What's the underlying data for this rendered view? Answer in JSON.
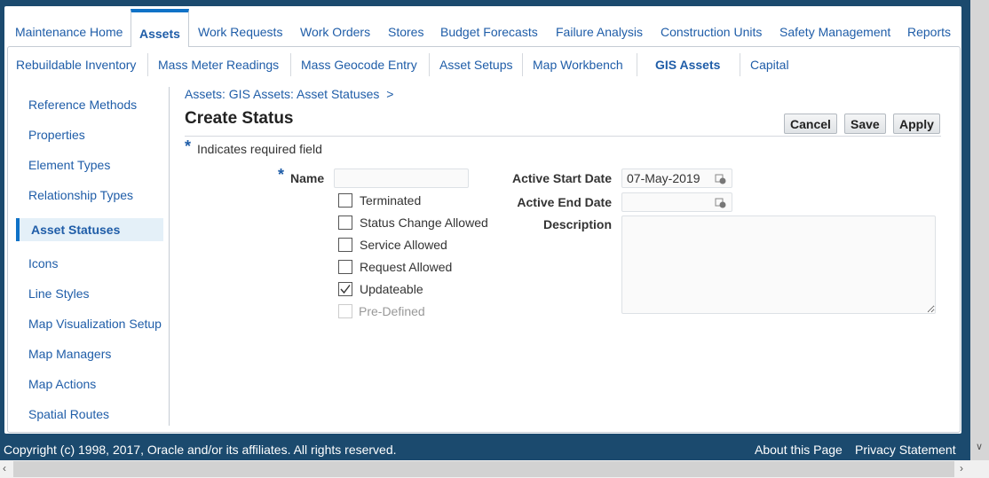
{
  "tabs": [
    "Maintenance Home",
    "Assets",
    "Work Requests",
    "Work Orders",
    "Stores",
    "Budget Forecasts",
    "Failure Analysis",
    "Construction Units",
    "Safety Management",
    "Reports"
  ],
  "active_tab": "Assets",
  "subtabs": [
    "Rebuildable Inventory",
    "Mass Meter Readings",
    "Mass Geocode Entry",
    "Asset Setups",
    "Map Workbench",
    "GIS Assets",
    "Capital"
  ],
  "active_subtab": "GIS Assets",
  "sidebar": [
    "Reference Methods",
    "Properties",
    "Element Types",
    "Relationship Types",
    "Asset Statuses",
    "Icons",
    "Line Styles",
    "Map Visualization Setup",
    "Map Managers",
    "Map Actions",
    "Spatial Routes"
  ],
  "active_sidebar": "Asset Statuses",
  "breadcrumb": "Assets: GIS Assets: Asset Statuses",
  "breadcrumb_sep": ">",
  "page_title": "Create Status",
  "buttons": {
    "cancel": "Cancel",
    "save": "Save",
    "apply": "Apply"
  },
  "required_note": "Indicates required field",
  "required_mark": "*",
  "form": {
    "name_label": "Name",
    "name_value": "",
    "checkboxes": [
      {
        "label": "Terminated",
        "checked": false
      },
      {
        "label": "Status Change Allowed",
        "checked": false
      },
      {
        "label": "Service Allowed",
        "checked": false
      },
      {
        "label": "Request Allowed",
        "checked": false
      },
      {
        "label": "Updateable",
        "checked": true
      },
      {
        "label": "Pre-Defined",
        "checked": false,
        "disabled": true
      }
    ],
    "start_label": "Active Start Date",
    "start_value": "07-May-2019",
    "end_label": "Active End Date",
    "end_value": "",
    "desc_label": "Description",
    "desc_value": ""
  },
  "footer": {
    "copyright": "Copyright (c) 1998, 2017, Oracle and/or its affiliates. All rights reserved.",
    "about": "About this Page",
    "privacy": "Privacy Statement"
  }
}
